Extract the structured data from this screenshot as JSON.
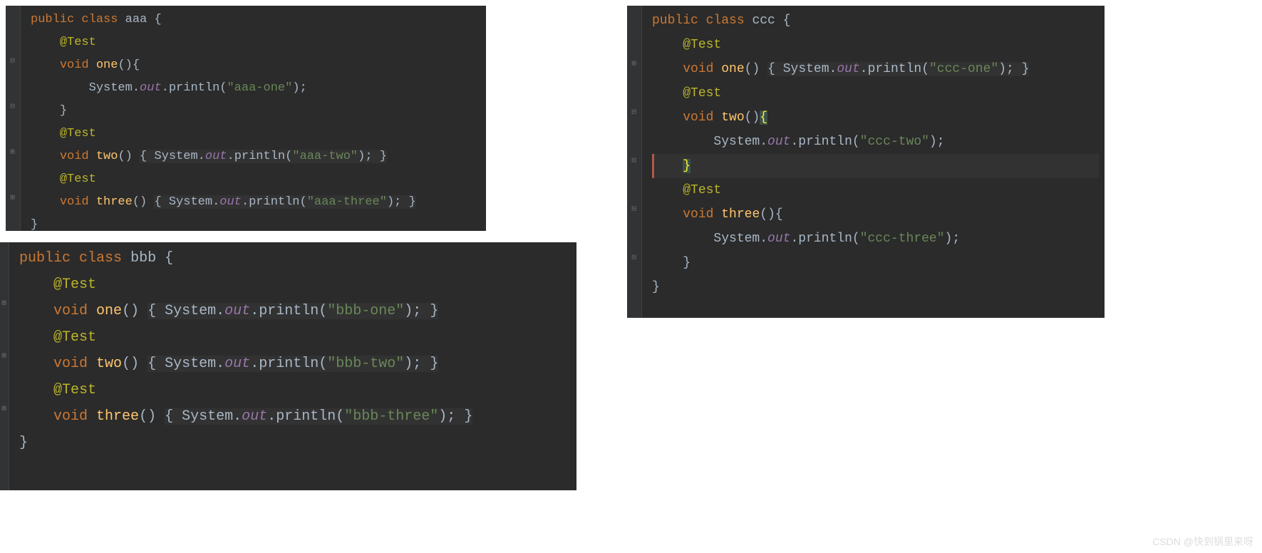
{
  "watermark": "CSDN @快到锅里来呀",
  "aaa": {
    "kw_public": "public",
    "kw_class": "class",
    "name": "aaa",
    "open": "{",
    "test": "@Test",
    "kw_void": "void",
    "m1": "one",
    "call_sys": "System",
    "call_out": "out",
    "call_println": "println",
    "s1": "\"aaa-one\"",
    "m2": "two",
    "s2": "\"aaa-two\"",
    "m3": "three",
    "s3": "\"aaa-three\"",
    "close": "}",
    "paren_open": "(",
    "paren_close": ")",
    "semi": ";",
    "dot": "."
  },
  "bbb": {
    "kw_public": "public",
    "kw_class": "class",
    "name": "bbb",
    "open": "{",
    "test": "@Test",
    "kw_void": "void",
    "m1": "one",
    "call_sys": "System",
    "call_out": "out",
    "call_println": "println",
    "s1": "\"bbb-one\"",
    "m2": "two",
    "s2": "\"bbb-two\"",
    "m3": "three",
    "s3": "\"bbb-three\"",
    "close": "}",
    "paren_open": "(",
    "paren_close": ")",
    "semi": ";",
    "dot": "."
  },
  "ccc": {
    "kw_public": "public",
    "kw_class": "class",
    "name": "ccc",
    "open": "{",
    "test": "@Test",
    "kw_void": "void",
    "m1": "one",
    "call_sys": "System",
    "call_out": "out",
    "call_println": "println",
    "s1": "\"ccc-one\"",
    "m2": "two",
    "s2": "\"ccc-two\"",
    "m3": "three",
    "s3": "\"ccc-three\"",
    "close": "}",
    "paren_open": "(",
    "paren_close": ")",
    "semi": ";",
    "dot": "."
  }
}
